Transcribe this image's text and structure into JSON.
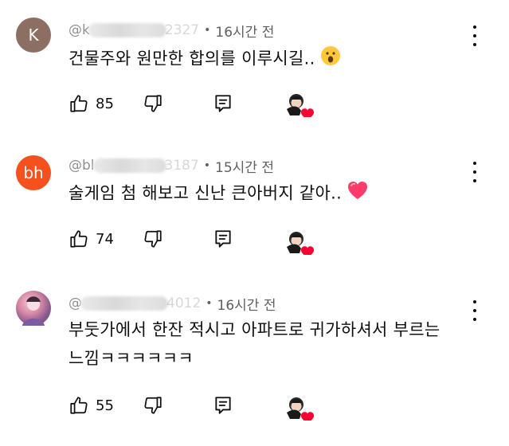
{
  "comments": [
    {
      "avatar_letter": "K",
      "avatar_color": "#8d6e63",
      "handle_prefix": "@k",
      "handle_suffix": "2327",
      "time": "16시간 전",
      "text": "건물주와 원만한 합의를 이루시길..",
      "emoji": "surprised-face-emoji",
      "likes": "85"
    },
    {
      "avatar_letter": "bh",
      "avatar_color": "#f4511e",
      "handle_prefix": "@bl",
      "handle_suffix": "3187",
      "time": "15시간 전",
      "text": "술게임 첨 해보고 신난 큰아버지 같아..",
      "emoji": "red-heart-emoji",
      "likes": "74"
    },
    {
      "avatar_letter": "",
      "avatar_color": "#d98aa6",
      "handle_prefix": "@",
      "handle_suffix": "4012",
      "time": "16시간 전",
      "text_line1": "부둣가에서 한잔 적시고 아파트로 귀가하셔서 부르는",
      "text_line2": "느낌ㅋㅋㅋㅋㅋㅋ",
      "likes": "55"
    }
  ],
  "icons": {
    "like": "thumbs-up-icon",
    "dislike": "thumbs-down-icon",
    "reply": "reply-icon",
    "more": "more-vertical-icon",
    "creator_heart": "creator-heart-badge"
  },
  "colors": {
    "heart": "#ff0033",
    "meta": "#606060",
    "text": "#0f0f0f"
  }
}
